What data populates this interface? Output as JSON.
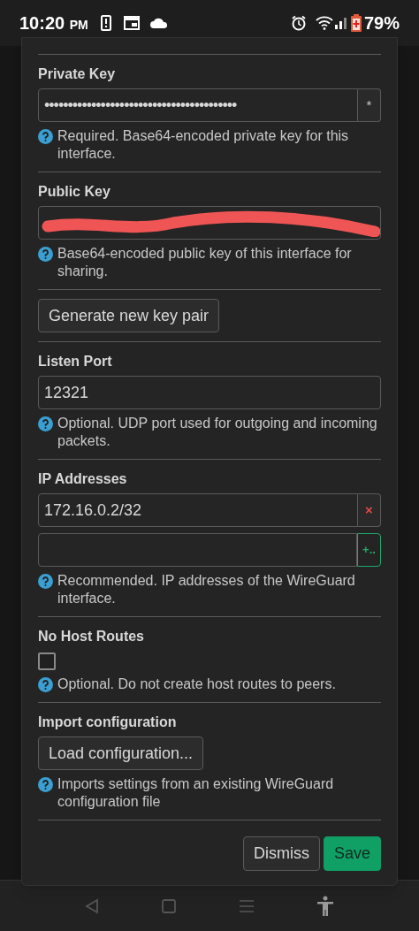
{
  "status_bar": {
    "time": "10:20",
    "ampm": "PM",
    "battery": "79%"
  },
  "sections": [
    {
      "kind": "key",
      "label": "Private Key",
      "value": "•••••••••••••••••••••••••••••••••••••••••",
      "toggle": "*",
      "hint": "Required. Base64-encoded private key for this interface."
    },
    {
      "kind": "redacted",
      "label": "Public Key",
      "hint": "Base64-encoded public key of this interface for sharing."
    },
    {
      "kind": "button",
      "button": "Generate new key pair"
    },
    {
      "kind": "input",
      "label": "Listen Port",
      "value": "12321",
      "hint": "Optional. UDP port used for outgoing and incoming packets."
    },
    {
      "kind": "list",
      "label": "IP Addresses",
      "items": [
        {
          "value": "172.16.0.2/32",
          "remove": "×"
        }
      ],
      "add": "+..",
      "hint": "Recommended. IP addresses of the WireGuard interface."
    },
    {
      "kind": "checkbox",
      "label": "No Host Routes",
      "checked": false,
      "hint": "Optional. Do not create host routes to peers."
    },
    {
      "kind": "button",
      "label": "Import configuration",
      "button": "Load configuration...",
      "hint": "Imports settings from an existing WireGuard configuration file"
    }
  ],
  "actions": [
    {
      "label": "Dismiss",
      "kind": "neutral"
    },
    {
      "label": "Save",
      "kind": "primary"
    }
  ]
}
